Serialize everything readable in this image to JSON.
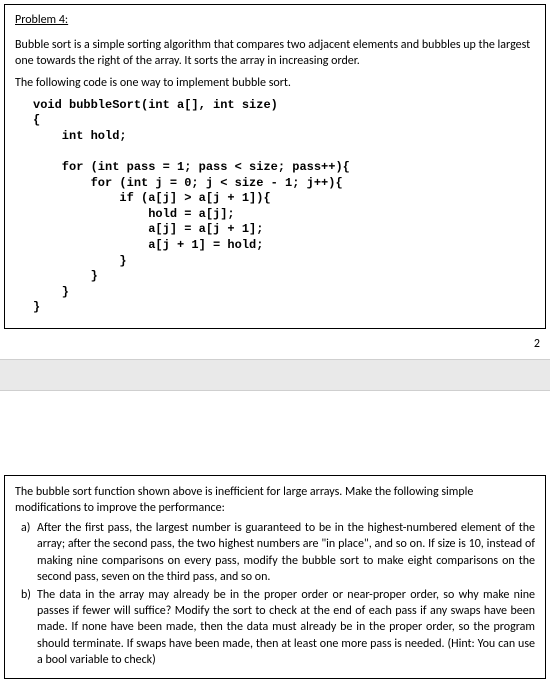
{
  "problem": {
    "title": "Problem 4:",
    "p1": "Bubble sort is a simple sorting algorithm that compares two adjacent elements and bubbles up the largest one towards the right of the array. It sorts the array in increasing order.",
    "p2": "The following code is one way to implement bubble sort.",
    "code": "void bubbleSort(int a[], int size)\n{\n    int hold;\n\n    for (int pass = 1; pass < size; pass++){\n        for (int j = 0; j < size - 1; j++){\n            if (a[j] > a[j + 1]){\n                hold = a[j];\n                a[j] = a[j + 1];\n                a[j + 1] = hold;\n            }\n        }\n    }\n}"
  },
  "pagenum": "2",
  "mods": {
    "intro": "The bubble sort function shown above is inefficient for large arrays. Make the following simple modifications to improve the performance:",
    "a_label": "a)",
    "a_text": "After the first pass, the largest number is guaranteed to be in the highest-numbered element of the array; after the second pass, the two highest numbers are \"in place\", and so on. If size is 10, instead of making nine comparisons on every pass, modify the bubble sort to make eight comparisons on the second pass, seven on the third pass, and so on.",
    "b_label": "b)",
    "b_text": "The data in the array may already be in the proper order or near-proper order, so why make nine passes if fewer will suffice?  Modify the sort to check at the end of each pass if any swaps have been made. If none have been made, then the data must already be in the proper order, so the program should terminate. If swaps have been made, then at least one more pass is needed. (Hint: You can use a bool variable to check)"
  }
}
